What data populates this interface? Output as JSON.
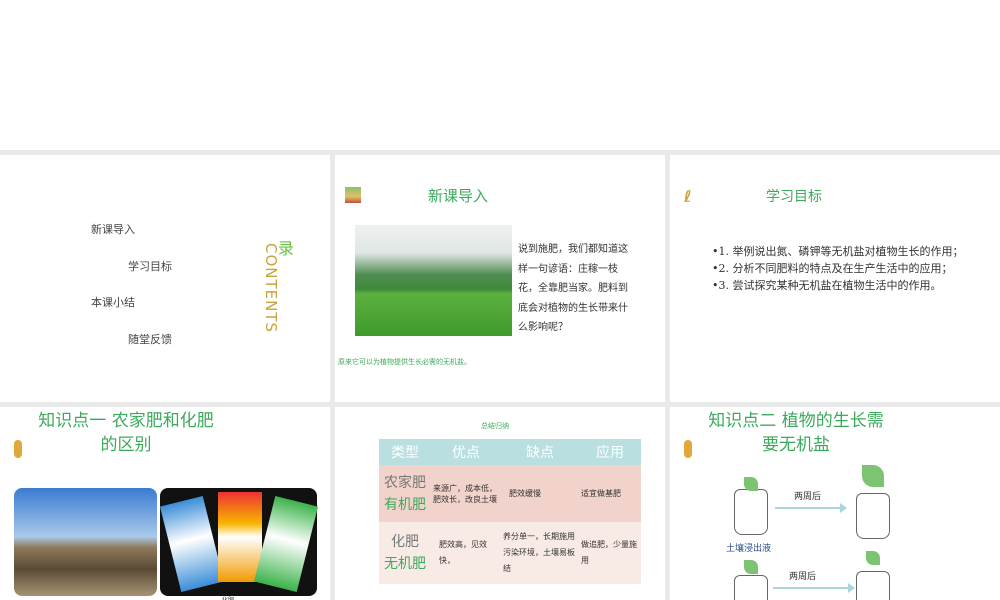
{
  "toc": {
    "items": [
      "新课导入",
      "学习目标",
      "本课小结",
      "随堂反馈"
    ],
    "title_char": "录",
    "contents": "CONTENTS"
  },
  "intro": {
    "title": "新课导入",
    "text": "说到施肥，我们都知道这样一句谚语：庄稼一枝花，全靠肥当家。肥料到底会对植物的生长带来什么影响呢？",
    "conclusion": "原来它可以为植物提供生长必需的无机盐。"
  },
  "goals": {
    "title": "学习目标",
    "items": [
      "•1. 举例说出氮、磷钾等无机盐对植物生长的作用；",
      "•2. 分析不同肥料的特点及在生产生活中的应用；",
      "•3. 尝试探究某种无机盐在植物生活中的作用。"
    ]
  },
  "kp1": {
    "title": "知识点一  农家肥和化肥的区别",
    "caption": "化肥"
  },
  "summary": {
    "title": "总结归纳",
    "headers": [
      "类型",
      "优点",
      "缺点",
      "应用"
    ],
    "rows": [
      {
        "type_a": "农家肥",
        "type_b": "有机肥",
        "pros": "来源广，成本低，肥效长，改良土壤",
        "cons": "肥效缓慢",
        "use": "适宜做基肥"
      },
      {
        "type_a": "化肥",
        "type_b": "无机肥",
        "pros": "肥效高，见效快，",
        "cons": "养分单一，长期施用污染环境，土壤易板结",
        "use": "做追肥，少量施用"
      }
    ]
  },
  "kp2": {
    "title": "知识点二  植物的生长需要无机盐",
    "arrow_label": "两周后",
    "liquid_label": "土壤浸出液"
  }
}
